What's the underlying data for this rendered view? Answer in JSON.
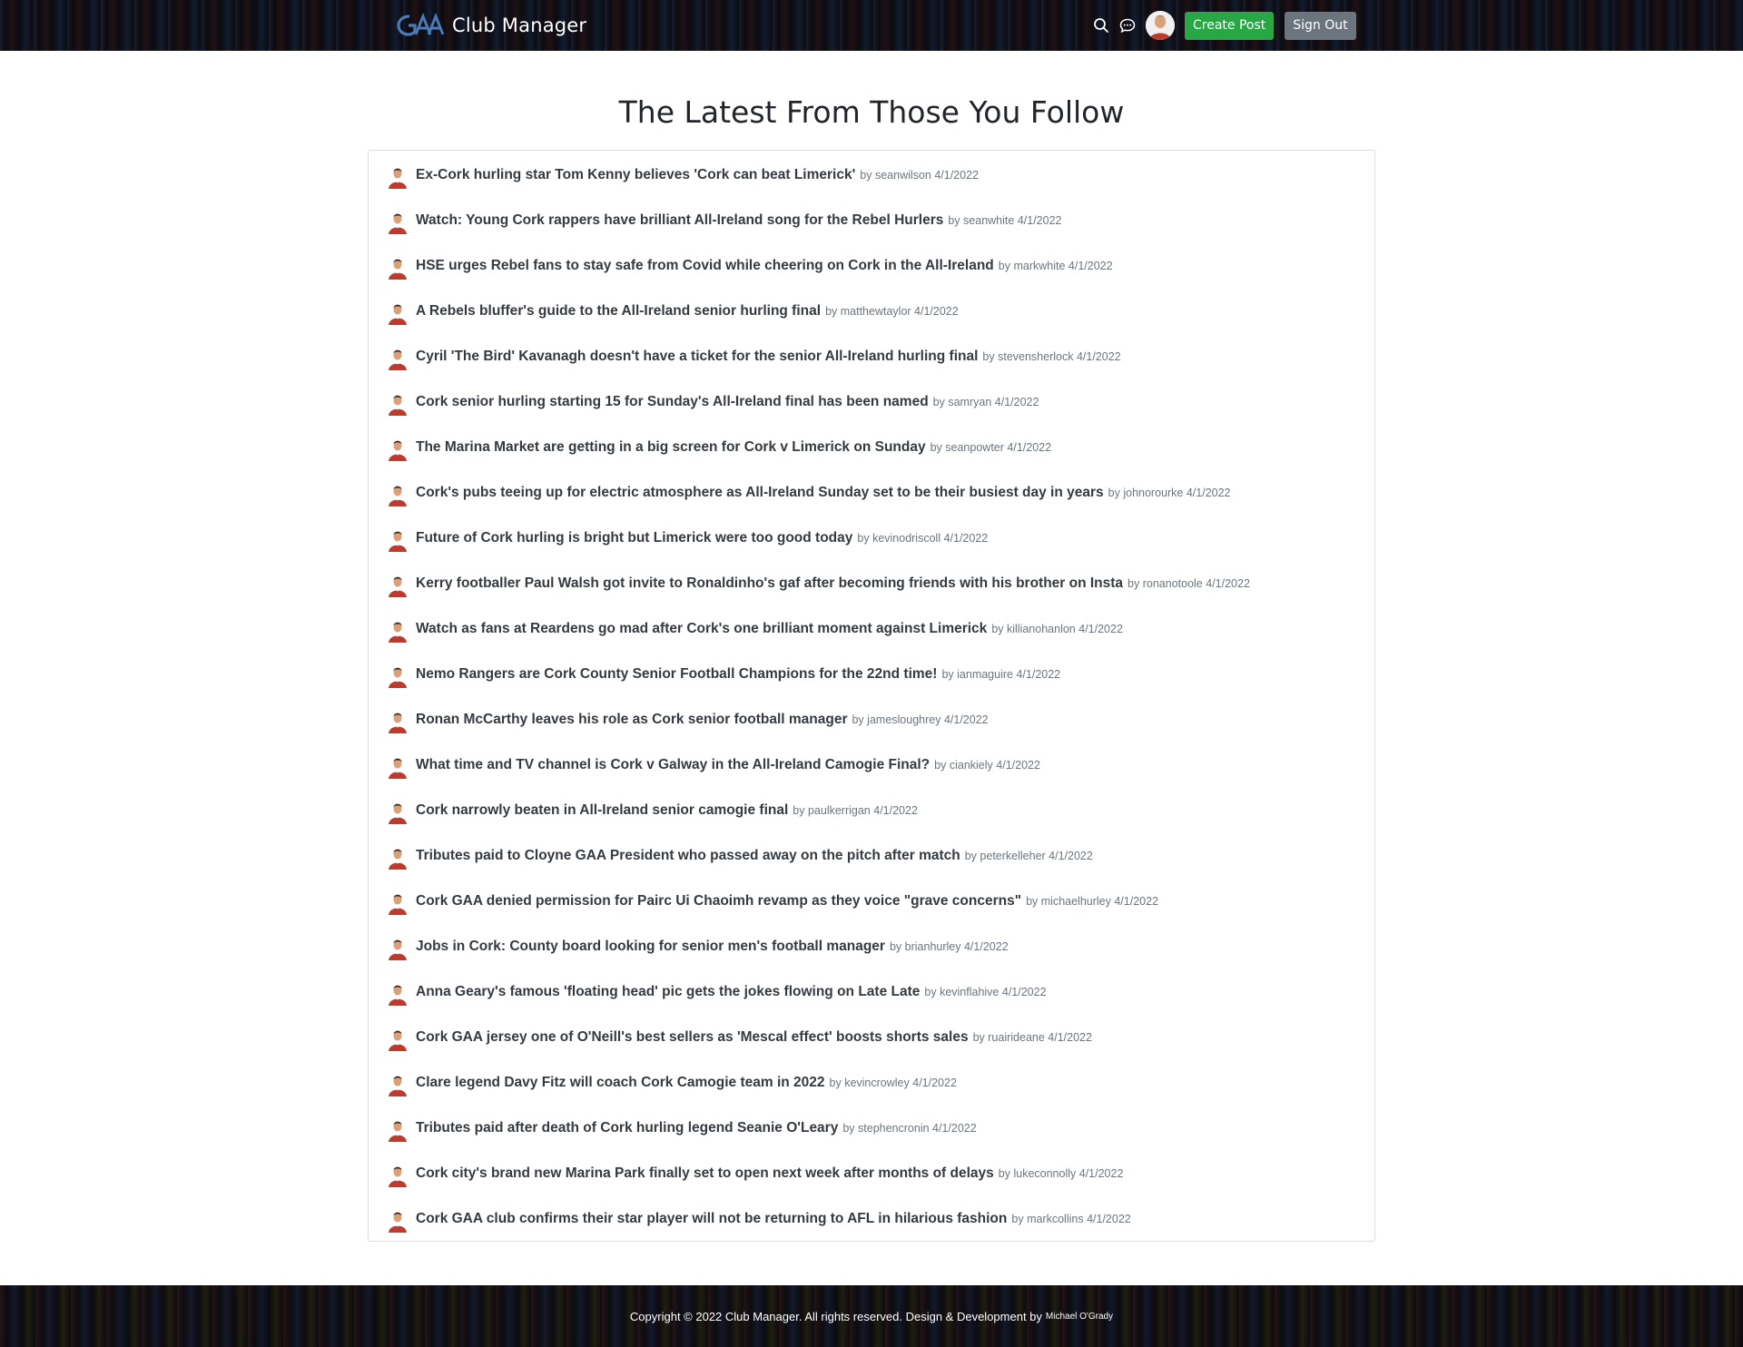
{
  "header": {
    "brand_name": "Club Manager",
    "create_post_label": "Create Post",
    "sign_out_label": "Sign Out",
    "icons": [
      "search-icon",
      "chat-icon"
    ]
  },
  "page": {
    "title": "The Latest From Those You Follow"
  },
  "posts": [
    {
      "title": "Ex-Cork hurling star Tom Kenny believes 'Cork can beat Limerick'",
      "author": "seanwilson",
      "date": "4/1/2022"
    },
    {
      "title": "Watch: Young Cork rappers have brilliant All-Ireland song for the Rebel Hurlers",
      "author": "seanwhite",
      "date": "4/1/2022"
    },
    {
      "title": "HSE urges Rebel fans to stay safe from Covid while cheering on Cork in the All-Ireland",
      "author": "markwhite",
      "date": "4/1/2022"
    },
    {
      "title": "A Rebels bluffer's guide to the All-Ireland senior hurling final",
      "author": "matthewtaylor",
      "date": "4/1/2022"
    },
    {
      "title": "Cyril 'The Bird' Kavanagh doesn't have a ticket for the senior All-Ireland hurling final",
      "author": "stevensherlock",
      "date": "4/1/2022"
    },
    {
      "title": "Cork senior hurling starting 15 for Sunday's All-Ireland final has been named",
      "author": "samryan",
      "date": "4/1/2022"
    },
    {
      "title": "The Marina Market are getting in a big screen for Cork v Limerick on Sunday",
      "author": "seanpowter",
      "date": "4/1/2022"
    },
    {
      "title": "Cork's pubs teeing up for electric atmosphere as All-Ireland Sunday set to be their busiest day in years",
      "author": "johnorourke",
      "date": "4/1/2022"
    },
    {
      "title": "Future of Cork hurling is bright but Limerick were too good today",
      "author": "kevinodriscoll",
      "date": "4/1/2022"
    },
    {
      "title": "Kerry footballer Paul Walsh got invite to Ronaldinho's gaf after becoming friends with his brother on Insta",
      "author": "ronanotoole",
      "date": "4/1/2022"
    },
    {
      "title": "Watch as fans at Reardens go mad after Cork's one brilliant moment against Limerick",
      "author": "killianohanlon",
      "date": "4/1/2022"
    },
    {
      "title": "Nemo Rangers are Cork County Senior Football Champions for the 22nd time!",
      "author": "ianmaguire",
      "date": "4/1/2022"
    },
    {
      "title": "Ronan McCarthy leaves his role as Cork senior football manager",
      "author": "jamesloughrey",
      "date": "4/1/2022"
    },
    {
      "title": "What time and TV channel is Cork v Galway in the All-Ireland Camogie Final?",
      "author": "ciankiely",
      "date": "4/1/2022"
    },
    {
      "title": "Cork narrowly beaten in All-Ireland senior camogie final",
      "author": "paulkerrigan",
      "date": "4/1/2022"
    },
    {
      "title": "Tributes paid to Cloyne GAA President who passed away on the pitch after match",
      "author": "peterkelleher",
      "date": "4/1/2022"
    },
    {
      "title": "Cork GAA denied permission for Pairc Ui Chaoimh revamp as they voice \"grave concerns\"",
      "author": "michaelhurley",
      "date": "4/1/2022"
    },
    {
      "title": "Jobs in Cork: County board looking for senior men's football manager",
      "author": "brianhurley",
      "date": "4/1/2022"
    },
    {
      "title": "Anna Geary's famous 'floating head' pic gets the jokes flowing on Late Late",
      "author": "kevinflahive",
      "date": "4/1/2022"
    },
    {
      "title": "Cork GAA jersey one of O'Neill's best sellers as 'Mescal effect' boosts shorts sales",
      "author": "ruairideane",
      "date": "4/1/2022"
    },
    {
      "title": "Clare legend Davy Fitz will coach Cork Camogie team in 2022",
      "author": "kevincrowley",
      "date": "4/1/2022"
    },
    {
      "title": "Tributes paid after death of Cork hurling legend Seanie O'Leary",
      "author": "stephencronin",
      "date": "4/1/2022"
    },
    {
      "title": "Cork city's brand new Marina Park finally set to open next week after months of delays",
      "author": "lukeconnolly",
      "date": "4/1/2022"
    },
    {
      "title": "Cork GAA club confirms their star player will not be returning to AFL in hilarious fashion",
      "author": "markcollins",
      "date": "4/1/2022"
    }
  ],
  "footer": {
    "text": "Copyright © 2022 Club Manager. All rights reserved. Design & Development by",
    "credit": "Michael O'Grady"
  },
  "colors": {
    "create_post": "#28a745",
    "sign_out": "#6c757d",
    "logo_blue": "#4a7bb7",
    "avatar_red": "#c0392b"
  }
}
